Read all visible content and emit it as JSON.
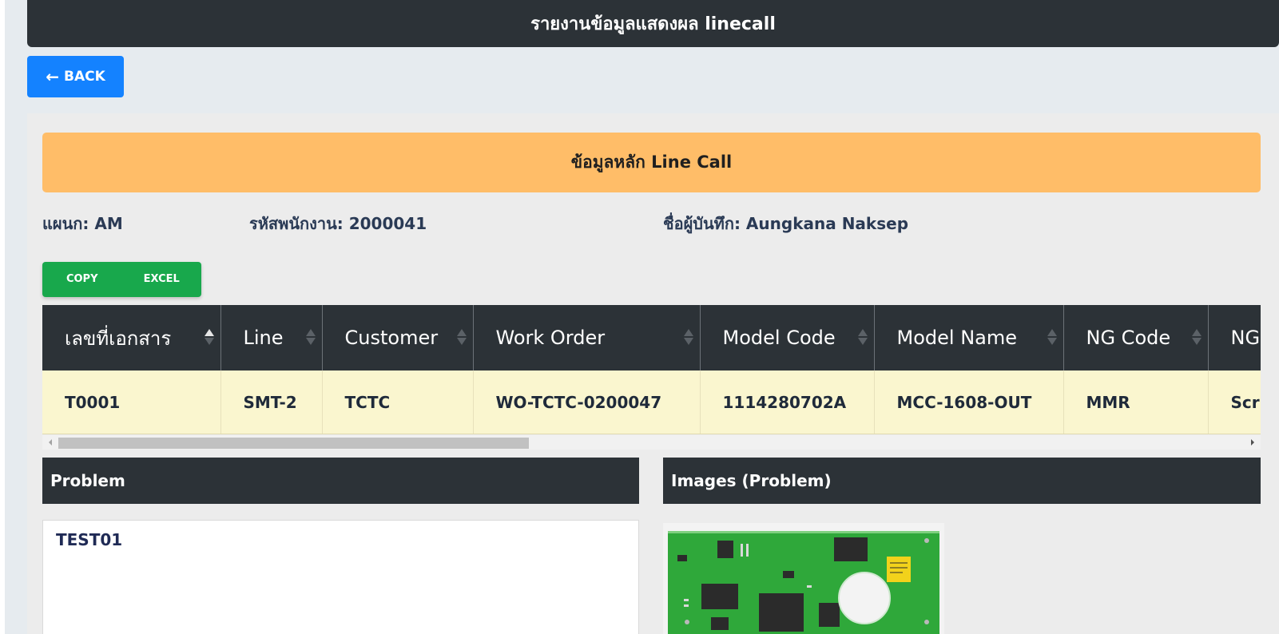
{
  "header": {
    "title": "รายงานข้อมูลแสดงผล linecall"
  },
  "back_button": {
    "label": "BACK"
  },
  "main_section": {
    "title": "ข้อมูลหลัก Line Call"
  },
  "info": {
    "department": "แผนก: AM",
    "employee_id": "รหัสพนักงาน: 2000041",
    "recorder": "ชื่อผู้บันทึก: Aungkana Naksep"
  },
  "export": {
    "copy_label": "COPY",
    "excel_label": "EXCEL"
  },
  "table": {
    "columns": [
      "เลขที่เอกสาร",
      "Line",
      "Customer",
      "Work Order",
      "Model Code",
      "Model Name",
      "NG Code",
      "NG"
    ],
    "rows": [
      [
        "T0001",
        "SMT-2",
        "TCTC",
        "WO-TCTC-0200047",
        "1114280702A",
        "MCC-1608-OUT",
        "MMR",
        "Scr"
      ]
    ]
  },
  "problem": {
    "title": "Problem",
    "text": "TEST01"
  },
  "images": {
    "title": "Images (Problem)"
  },
  "colors": {
    "header_bg": "#2c3237",
    "accent_blue": "#1482ff",
    "banner_orange": "#ffbd68",
    "export_green": "#18a84c",
    "row_highlight": "#faf6cf"
  }
}
